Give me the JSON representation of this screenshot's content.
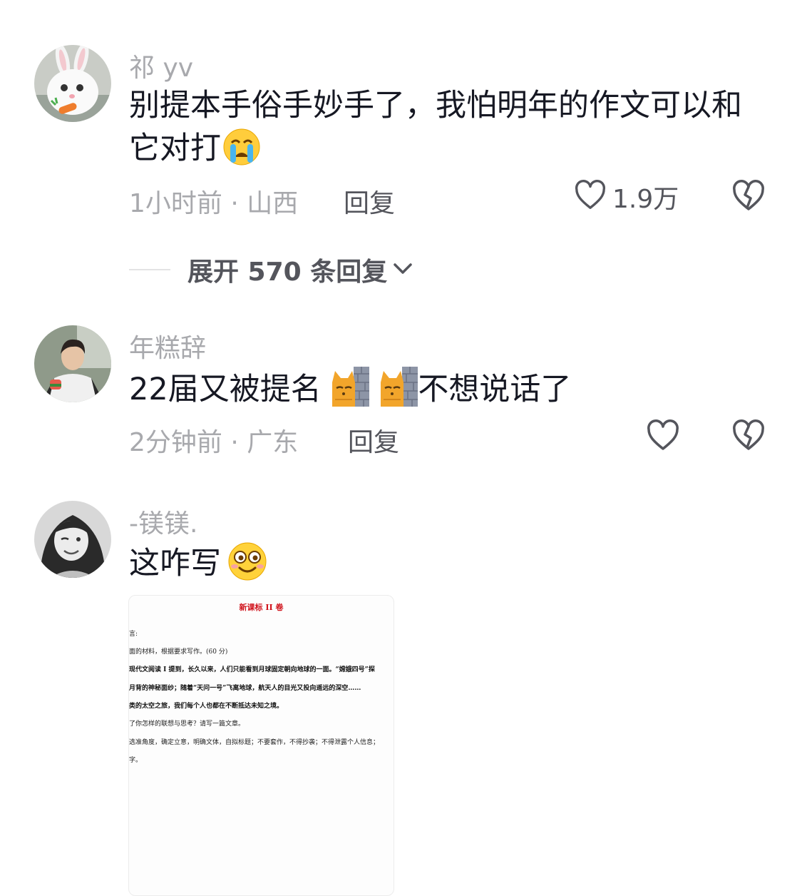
{
  "comments": [
    {
      "username": "祁 yv",
      "text": "别提本手俗手妙手了，我怕明年的作文可以和它对打",
      "emoji": "crying-face-emoji",
      "meta": "1小时前 · 山西",
      "reply_label": "回复",
      "like_count": "1.9万"
    },
    {
      "username": "年糕辞",
      "text_before": "22届又被提名",
      "text_after": "不想说话了",
      "emoji": "cat-peeking-wall-emoji",
      "meta": "2分钟前 · 广东",
      "reply_label": "回复",
      "like_count": ""
    },
    {
      "username": "-镁镁.",
      "text": "这咋写",
      "emoji": "smiling-face-emoji",
      "image": {
        "title": "新课标 II 卷",
        "lines": [
          "言:",
          "面的材料，根据要求写作。(60 分)",
          "现代文阅读 I 提到，长久以来，人们只能看到月球固定朝向地球的一面。“嫦娥四号”探",
          "月背的神秘面纱；随着“天问一号”飞离地球，航天人的目光又投向遥远的深空……",
          "类的太空之旅，我们每个人也都在不断抵达未知之境。",
          "了你怎样的联想与思考？请写一篇文章。",
          "选准角度，确定立意，明确文体，自拟标题；不要套作，不得抄袭；不得泄露个人信息；",
          "字。"
        ]
      }
    }
  ],
  "expand_replies_label": "展开 570 条回复",
  "colors": {
    "primary_text": "#161823",
    "secondary_text": "#a8a9ad",
    "action_text": "#54555c",
    "doc_title_red": "#d0121b"
  }
}
